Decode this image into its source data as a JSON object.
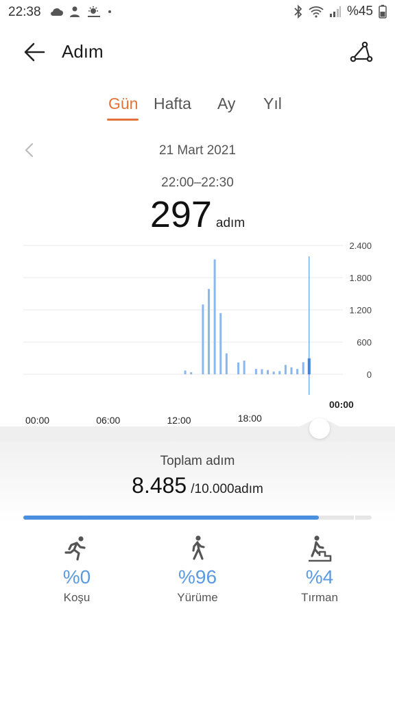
{
  "status_bar": {
    "time": "22:38",
    "battery": "%45",
    "left_icons": [
      "cloud-icon",
      "user-icon",
      "sun-cloud-icon",
      "dot-icon"
    ],
    "right_icons": [
      "bluetooth-icon",
      "wifi-icon",
      "signal-icon",
      "battery-icon"
    ]
  },
  "appbar": {
    "title": "Adım"
  },
  "tabs": [
    {
      "label": "Gün",
      "active": true
    },
    {
      "label": "Hafta",
      "active": false
    },
    {
      "label": "Ay",
      "active": false
    },
    {
      "label": "Yıl",
      "active": false
    }
  ],
  "date": "21 Mart 2021",
  "selection": {
    "range": "22:00–22:30",
    "steps": "297",
    "unit": "adım"
  },
  "chart_data": {
    "type": "bar",
    "x_ticks": [
      "00:00",
      "06:00",
      "12:00",
      "18:00"
    ],
    "selected_tick": "00:00",
    "y_ticks": [
      "2.400",
      "1.800",
      "1.200",
      "600",
      "0"
    ],
    "ylim": [
      0,
      2400
    ],
    "grid": true,
    "color": "#8ab8ee",
    "highlight_color": "#3a86e0",
    "bars": [
      {
        "t": "12:30",
        "value": 70
      },
      {
        "t": "13:00",
        "value": 40
      },
      {
        "t": "14:00",
        "value": 1300
      },
      {
        "t": "14:30",
        "value": 1590
      },
      {
        "t": "15:00",
        "value": 2140
      },
      {
        "t": "15:30",
        "value": 1140
      },
      {
        "t": "16:00",
        "value": 390
      },
      {
        "t": "17:00",
        "value": 220
      },
      {
        "t": "17:30",
        "value": 255
      },
      {
        "t": "18:30",
        "value": 100
      },
      {
        "t": "19:00",
        "value": 95
      },
      {
        "t": "19:30",
        "value": 80
      },
      {
        "t": "20:00",
        "value": 50
      },
      {
        "t": "20:30",
        "value": 60
      },
      {
        "t": "21:00",
        "value": 175
      },
      {
        "t": "21:30",
        "value": 130
      },
      {
        "t": "22:00",
        "value": 100
      },
      {
        "t": "22:30",
        "value": 225
      },
      {
        "t": "23:00",
        "value": 297,
        "selected": true
      }
    ]
  },
  "summary": {
    "total_label": "Toplam adım",
    "total": "8.485",
    "goal": "/10.000adım",
    "progress": 0.8485
  },
  "activities": [
    {
      "icon": "running-icon",
      "pct": "%0",
      "label": "Koşu"
    },
    {
      "icon": "walking-icon",
      "pct": "%96",
      "label": "Yürüme"
    },
    {
      "icon": "climbing-icon",
      "pct": "%4",
      "label": "Tırman"
    }
  ]
}
